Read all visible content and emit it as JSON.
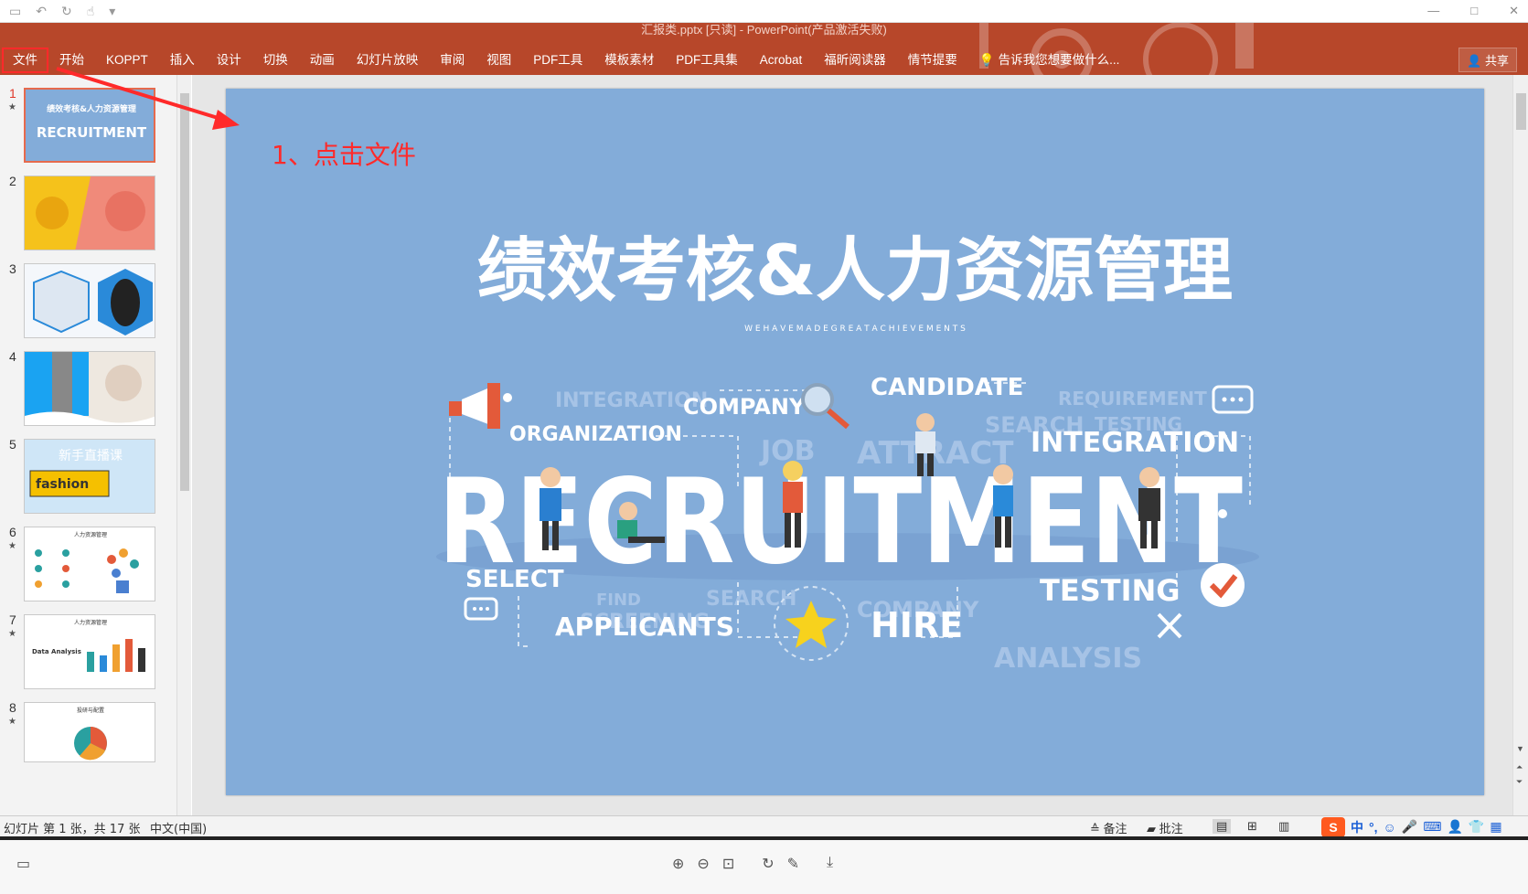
{
  "app": {
    "title": "汇报类.pptx [只读] - PowerPoint(产品激活失败)",
    "share": "共享"
  },
  "ribbon": {
    "tabs": [
      "文件",
      "开始",
      "KOPPT",
      "插入",
      "设计",
      "切换",
      "动画",
      "幻灯片放映",
      "审阅",
      "视图",
      "PDF工具",
      "模板素材",
      "PDF工具集",
      "Acrobat",
      "福昕阅读器",
      "情节提要"
    ],
    "tellme": "告诉我您想要做什么..."
  },
  "annotation": {
    "text": "1、点击文件",
    "color": "#ff2a2a"
  },
  "slides": [
    {
      "num": "1",
      "star": true,
      "title": "绩效考核&人力资源管理",
      "word": "RECRUITMENT"
    },
    {
      "num": "2",
      "star": false
    },
    {
      "num": "3",
      "star": false
    },
    {
      "num": "4",
      "star": false
    },
    {
      "num": "5",
      "star": false,
      "text1": "新手直播课",
      "text2": "fashion"
    },
    {
      "num": "6",
      "star": true,
      "title": "人力资源管理"
    },
    {
      "num": "7",
      "star": true,
      "title": "人力资源管理",
      "text": "Data Analysis"
    },
    {
      "num": "8",
      "star": true,
      "title": "投研与配置"
    }
  ],
  "slide": {
    "title": "绩效考核&人力资源管理",
    "subtitle": "W E   H A V E   M A D E   G R E A T   A C H I E V E M E N T S",
    "main": "RECRUITMENT",
    "keywords": {
      "company": "COMPANY",
      "candidate": "CANDIDATE",
      "organization": "ORGANIZATION",
      "integration": "INTEGRATION",
      "select": "SELECT",
      "applicants": "APPLICANTS",
      "hire": "HIRE",
      "testing": "TESTING"
    },
    "faded": {
      "integration": "INTEGRATION",
      "requirement": "REQUIREMENT",
      "testing": "TESTING",
      "search": "SEARCH",
      "job": "JOB",
      "attract": "ATTRACT",
      "find": "FIND",
      "screening": "SCREENING",
      "search2": "SEARCH",
      "company": "COMPANY",
      "analysis": "ANALYSIS"
    }
  },
  "status": {
    "slide_info": "幻灯片 第 1 张，共 17 张",
    "language": "中文(中国)",
    "notes": "备注",
    "comments": "批注",
    "ime": "中"
  },
  "colors": {
    "ribbon": "#b7472a",
    "slide_bg": "#83acd9",
    "accent": "#e66a4d"
  }
}
